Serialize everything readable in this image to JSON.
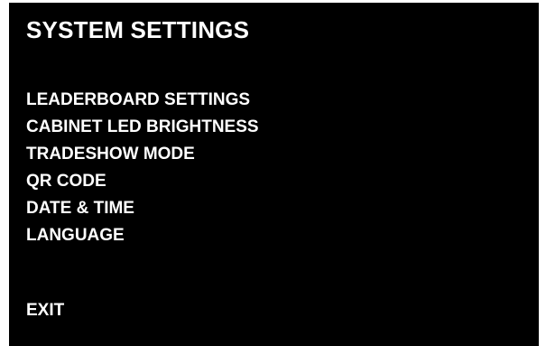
{
  "screen": {
    "title": "SYSTEM SETTINGS",
    "menu_items": [
      {
        "label": "LEADERBOARD SETTINGS"
      },
      {
        "label": "CABINET LED BRIGHTNESS"
      },
      {
        "label": "TRADESHOW MODE"
      },
      {
        "label": "QR CODE"
      },
      {
        "label": "DATE & TIME"
      },
      {
        "label": "LANGUAGE"
      }
    ],
    "exit_label": "EXIT"
  },
  "colors": {
    "background": "#000000",
    "text": "#ffffff"
  }
}
